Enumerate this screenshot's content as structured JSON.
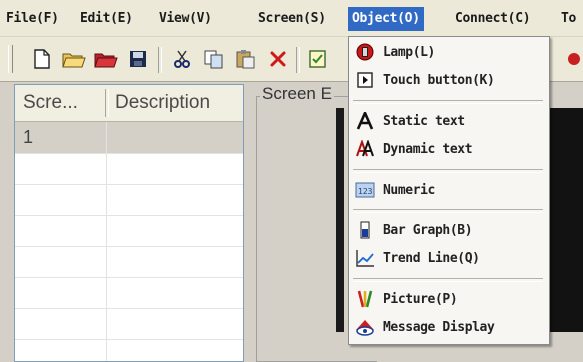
{
  "menubar": {
    "items": [
      {
        "label": "File(F)"
      },
      {
        "label": "Edit(E)"
      },
      {
        "label": "View(V)"
      },
      {
        "label": "Screen(S)"
      },
      {
        "label": "Object(O)",
        "active": true
      },
      {
        "label": "Connect(C)"
      },
      {
        "label": "To"
      }
    ]
  },
  "toolbar": {
    "buttons": [
      "new-file-icon",
      "open-folder-icon",
      "open-red-icon",
      "save-icon",
      "cut-icon",
      "copy-icon",
      "paste-icon",
      "delete-icon",
      "compile-icon"
    ]
  },
  "screen_list": {
    "columns": [
      {
        "label": "Scre..."
      },
      {
        "label": "Description"
      }
    ],
    "rows": [
      {
        "id": "1",
        "description": ""
      },
      {
        "id": "",
        "description": ""
      },
      {
        "id": "",
        "description": ""
      },
      {
        "id": "",
        "description": ""
      },
      {
        "id": "",
        "description": ""
      },
      {
        "id": "",
        "description": ""
      },
      {
        "id": "",
        "description": ""
      },
      {
        "id": "",
        "description": ""
      }
    ]
  },
  "editor": {
    "title": "Screen E"
  },
  "object_menu": {
    "items": [
      {
        "label": "Lamp(L)",
        "icon": "lamp-icon"
      },
      {
        "label": "Touch button(K)",
        "icon": "touch-button-icon"
      },
      {
        "label": "Static  text",
        "icon": "static-text-icon"
      },
      {
        "label": "Dynamic text",
        "icon": "dynamic-text-icon"
      },
      {
        "label": "Numeric",
        "icon": "numeric-icon"
      },
      {
        "label": "Bar Graph(B)",
        "icon": "bar-graph-icon"
      },
      {
        "label": "Trend Line(Q)",
        "icon": "trend-line-icon"
      },
      {
        "label": "Picture(P)",
        "icon": "picture-icon"
      },
      {
        "label": "Message Display",
        "icon": "message-display-icon"
      }
    ]
  },
  "colors": {
    "highlight": "#316ac5",
    "menu_bg": "#ece9d8"
  }
}
